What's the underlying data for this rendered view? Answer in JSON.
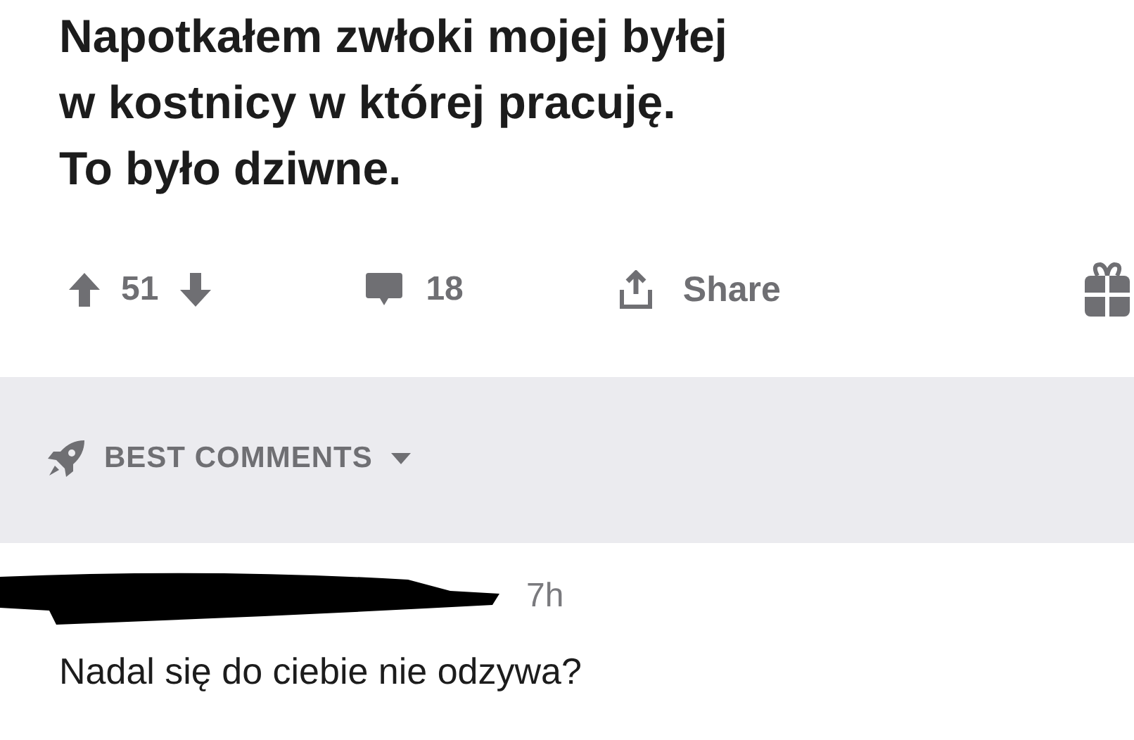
{
  "post": {
    "title_lines": [
      "Napotkałem zwłoki mojej byłej",
      "w kostnicy w której pracuję.",
      "To było dziwne."
    ],
    "votes": "51",
    "comments": "18",
    "share": "Share"
  },
  "sort": {
    "label": "BEST COMMENTS"
  },
  "comment": {
    "time": "7h",
    "text": "Nadal się do ciebie nie odzywa?"
  }
}
